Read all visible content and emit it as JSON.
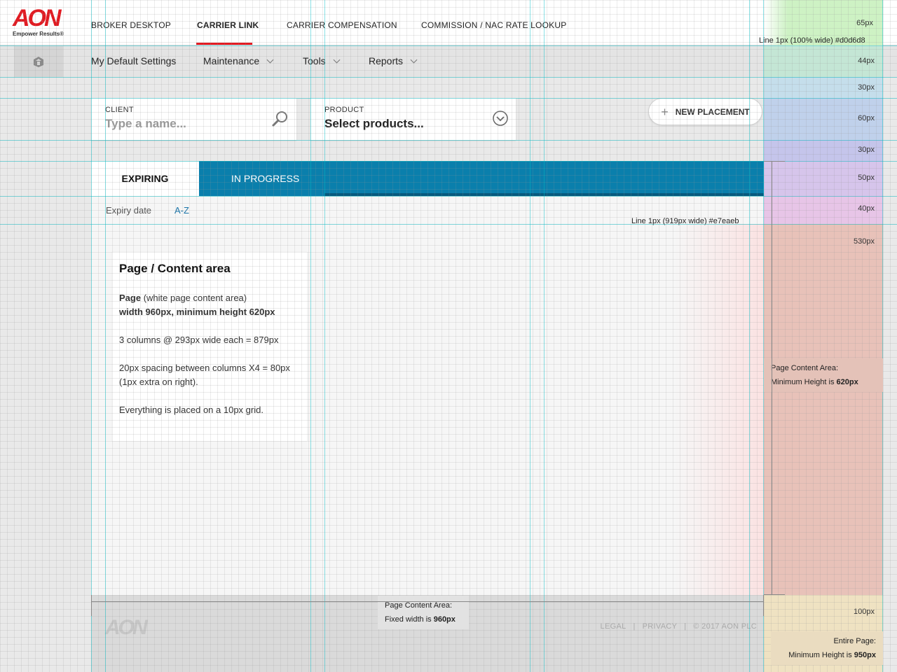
{
  "header": {
    "logo_brand": "AON",
    "logo_tagline": "Empower Results®",
    "nav": [
      "BROKER DESKTOP",
      "CARRIER LINK",
      "CARRIER COMPENSATION",
      "COMMISSION / NAC RATE LOOKUP"
    ],
    "active_nav": "CARRIER LINK"
  },
  "subnav": {
    "home_icon": "home-icon",
    "items": [
      "My Default Settings",
      "Maintenance",
      "Tools",
      "Reports"
    ]
  },
  "search": {
    "client_label": "CLIENT",
    "client_placeholder": "Type a name...",
    "product_label": "PRODUCT",
    "product_value": "Select products...",
    "new_placement": "NEW PLACEMENT"
  },
  "tabs": {
    "expiring": "EXPIRING",
    "in_progress": "IN PROGRESS"
  },
  "sort": {
    "label": "Expiry date",
    "link": "A-Z"
  },
  "info": {
    "title": "Page / Content area",
    "line1_bold": "Page",
    "line1_rest": " (white page content area)",
    "line2": "width 960px, minimum height 620px",
    "line3": "3 columns @ 293px wide each = 879px",
    "line4": "20px spacing between columns X4 = 80px (1px extra on right).",
    "line5": "Everything is placed on a 10px grid."
  },
  "annotations": {
    "h65": "65px",
    "line_full": "Line 1px (100% wide) #d0d6d8",
    "h44": "44px",
    "h30a": "30px",
    "h60": "60px",
    "h30b": "30px",
    "h50": "50px",
    "h40": "40px",
    "h530": "530px",
    "line_919": "Line 1px (919px wide) #e7eaeb",
    "content_area_title": "Page Content Area:",
    "min_height_label": "Minimum Height is ",
    "min_height_value": "620px",
    "h100": "100px",
    "entire_page": "Entire Page:",
    "entire_min_label": "Minimum Height is ",
    "entire_min_value": "950px",
    "fixed_title": "Page Content Area:",
    "fixed_label": "Fixed width is ",
    "fixed_value": "960px"
  },
  "footer": {
    "logo": "AON",
    "legal": "LEGAL",
    "privacy": "PRIVACY",
    "copyright": "© 2017 AON PLC",
    "sep": "|"
  },
  "colors": {
    "brand_red": "#e11b22",
    "tab_blue": "#0a7fac",
    "link_blue": "#1a74a8",
    "header_line": "#d0d6d8"
  }
}
